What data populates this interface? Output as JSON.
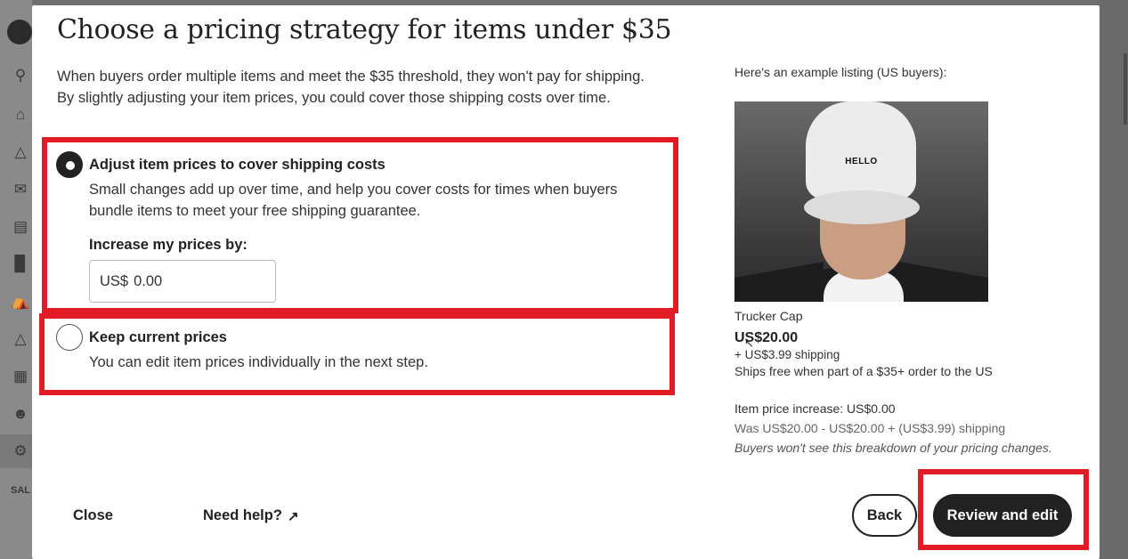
{
  "modal": {
    "title": "Choose a pricing strategy for items under $35",
    "intro": "When buyers order multiple items and meet the $35 threshold, they won't pay for shipping. By slightly adjusting your item prices, you could cover those shipping costs over time."
  },
  "options": [
    {
      "title": "Adjust item prices to cover shipping costs",
      "description": "Small changes add up over time, and help you cover costs for times when buyers bundle items to meet your free shipping guarantee.",
      "selected": true,
      "increase_label": "Increase my prices by:",
      "input_prefix": "US$",
      "input_value": "0.00"
    },
    {
      "title": "Keep current prices",
      "description": "You can edit item prices individually in the next step.",
      "selected": false
    }
  ],
  "example": {
    "label": "Here's an example listing (US buyers):",
    "cap_text": "HELLO",
    "name": "Trucker Cap",
    "price": "US$20.00",
    "shipping": "+ US$3.99 shipping",
    "free_note": "Ships free when part of a $35+ order to the US",
    "increase": "Item price increase: US$0.00",
    "was": "Was US$20.00 - US$20.00 + (US$3.99) shipping",
    "note": "Buyers won't see this breakdown of your pricing changes."
  },
  "footer": {
    "close_label": "Close",
    "help_label": "Need help?",
    "back_label": "Back",
    "review_label": "Review and edit"
  },
  "sidebar": {
    "section_label": "SAL"
  },
  "colors": {
    "highlight": "#e21b24",
    "primary_button": "#222222"
  },
  "icons": [
    "shop-logo-icon",
    "search-icon",
    "home-icon",
    "listings-icon",
    "messages-icon",
    "orders-icon",
    "stats-icon",
    "finances-icon",
    "marketing-icon",
    "apps-icon",
    "community-icon",
    "settings-icon",
    "external-link-icon"
  ]
}
